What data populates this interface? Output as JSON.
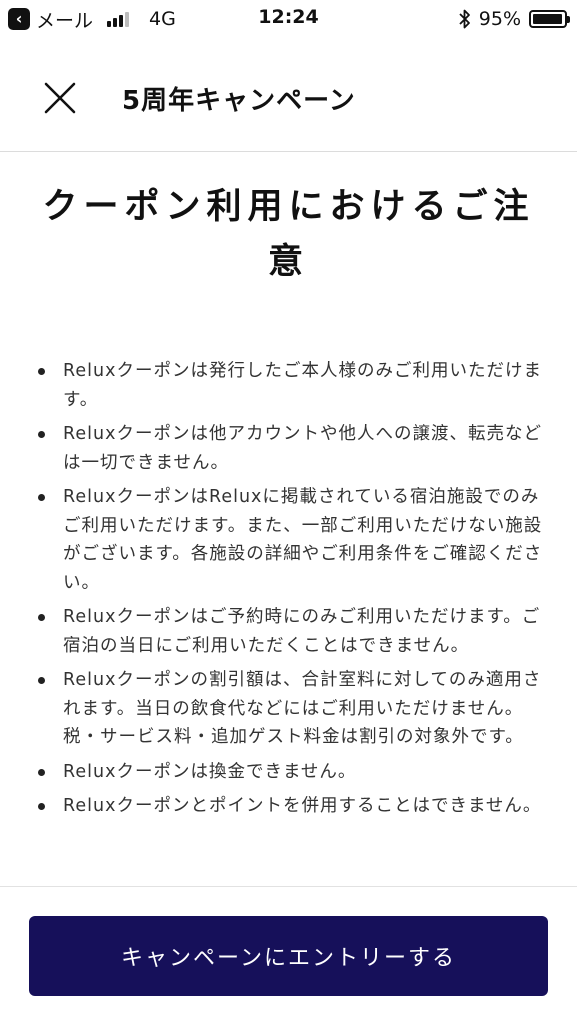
{
  "status_bar": {
    "back_app_label": "メール",
    "network": "4G",
    "time": "12:24",
    "battery_percent": "95%",
    "battery_level": 0.95,
    "signal_bars_active": 3,
    "signal_bars_total": 4
  },
  "header": {
    "title": "5周年キャンペーン"
  },
  "main": {
    "title": "クーポン利用におけるご注意",
    "notes": [
      "Reluxクーポンは発行したご本人様のみご利用いただけます。",
      "Reluxクーポンは他アカウントや他人への譲渡、転売などは一切できません。",
      "ReluxクーポンはReluxに掲載されている宿泊施設でのみご利用いただけます。また、一部ご利用いただけない施設がございます。各施設の詳細やご利用条件をご確認ください。",
      "Reluxクーポンはご予約時にのみご利用いただけます。ご宿泊の当日にご利用いただくことはできません。",
      "Reluxクーポンの割引額は、合計室料に対してのみ適用されます。当日の飲食代などにはご利用いただけません。 税・サービス料・追加ゲスト料金は割引の対象外です。",
      "Reluxクーポンは換金できません。",
      "Reluxクーポンとポイントを併用することはできません。"
    ]
  },
  "footer": {
    "entry_button_label": "キャンペーンにエントリーする"
  },
  "colors": {
    "primary_button": "#16105a",
    "text": "#222222",
    "divider": "#dcdcdc"
  }
}
